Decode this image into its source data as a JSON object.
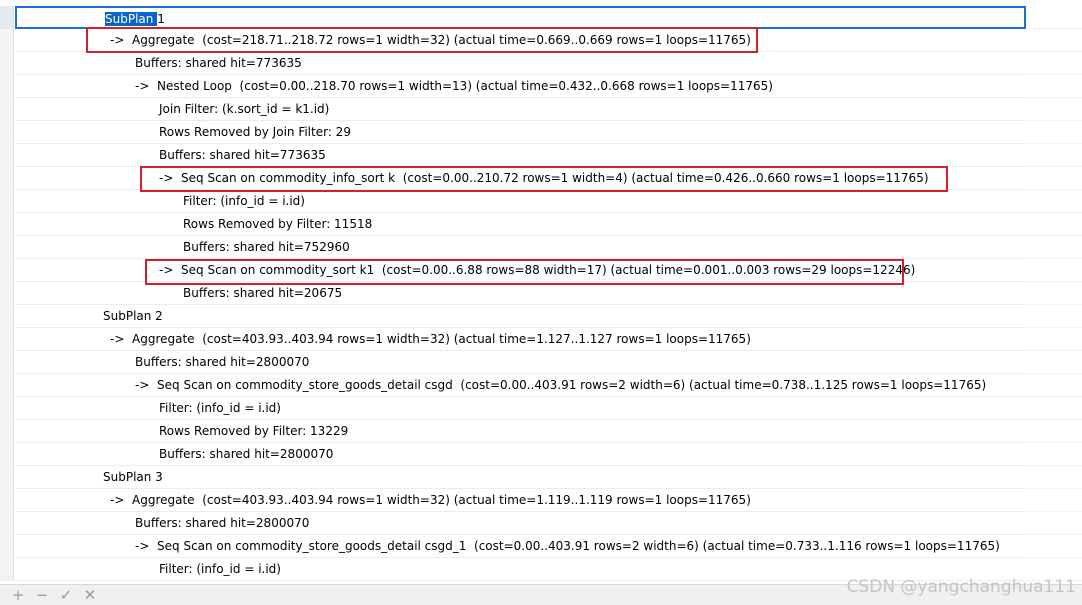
{
  "plan_rows": [
    {
      "segments": [
        {
          "text": "SubPlan ",
          "selected": true
        },
        {
          "text": "1",
          "selected": false
        }
      ]
    },
    {
      "segments": [
        {
          "text": "->  Aggregate  (cost=218.71..218.72 rows=1 width=32) (actual time=0.669..0.669 rows=1 loops=11765)",
          "selected": false
        }
      ]
    },
    {
      "segments": [
        {
          "text": "Buffers: shared hit=773635",
          "selected": false
        }
      ]
    },
    {
      "segments": [
        {
          "text": "->  Nested Loop  (cost=0.00..218.70 rows=1 width=13) (actual time=0.432..0.668 rows=1 loops=11765)",
          "selected": false
        }
      ]
    },
    {
      "segments": [
        {
          "text": "Join Filter: (k.sort_id = k1.id)",
          "selected": false
        }
      ]
    },
    {
      "segments": [
        {
          "text": "Rows Removed by Join Filter: 29",
          "selected": false
        }
      ]
    },
    {
      "segments": [
        {
          "text": "Buffers: shared hit=773635",
          "selected": false
        }
      ]
    },
    {
      "segments": [
        {
          "text": "->  Seq Scan on commodity_info_sort k  (cost=0.00..210.72 rows=1 width=4) (actual time=0.426..0.660 rows=1 loops=11765)",
          "selected": false
        }
      ]
    },
    {
      "segments": [
        {
          "text": "Filter: (info_id = i.id)",
          "selected": false
        }
      ]
    },
    {
      "segments": [
        {
          "text": "Rows Removed by Filter: 11518",
          "selected": false
        }
      ]
    },
    {
      "segments": [
        {
          "text": "Buffers: shared hit=752960",
          "selected": false
        }
      ]
    },
    {
      "segments": [
        {
          "text": "->  Seq Scan on commodity_sort k1  (cost=0.00..6.88 rows=88 width=17) (actual time=0.001..0.003 rows=29 loops=12246)",
          "selected": false
        }
      ]
    },
    {
      "segments": [
        {
          "text": "Buffers: shared hit=20675",
          "selected": false
        }
      ]
    },
    {
      "segments": [
        {
          "text": "SubPlan 2",
          "selected": false
        }
      ]
    },
    {
      "segments": [
        {
          "text": "->  Aggregate  (cost=403.93..403.94 rows=1 width=32) (actual time=1.127..1.127 rows=1 loops=11765)",
          "selected": false
        }
      ]
    },
    {
      "segments": [
        {
          "text": "Buffers: shared hit=2800070",
          "selected": false
        }
      ]
    },
    {
      "segments": [
        {
          "text": "->  Seq Scan on commodity_store_goods_detail csgd  (cost=0.00..403.91 rows=2 width=6) (actual time=0.738..1.125 rows=1 loops=11765)",
          "selected": false
        }
      ]
    },
    {
      "segments": [
        {
          "text": "Filter: (info_id = i.id)",
          "selected": false
        }
      ]
    },
    {
      "segments": [
        {
          "text": "Rows Removed by Filter: 13229",
          "selected": false
        }
      ]
    },
    {
      "segments": [
        {
          "text": "Buffers: shared hit=2800070",
          "selected": false
        }
      ]
    },
    {
      "segments": [
        {
          "text": "SubPlan 3",
          "selected": false
        }
      ]
    },
    {
      "segments": [
        {
          "text": "->  Aggregate  (cost=403.93..403.94 rows=1 width=32) (actual time=1.119..1.119 rows=1 loops=11765)",
          "selected": false
        }
      ]
    },
    {
      "segments": [
        {
          "text": "Buffers: shared hit=2800070",
          "selected": false
        }
      ]
    },
    {
      "segments": [
        {
          "text": "->  Seq Scan on commodity_store_goods_detail csgd_1  (cost=0.00..403.91 rows=2 width=6) (actual time=0.733..1.116 rows=1 loops=11765)",
          "selected": false
        }
      ]
    },
    {
      "segments": [
        {
          "text": "Filter: (info_id = i.id)",
          "selected": false
        }
      ]
    }
  ],
  "toolbar": {
    "add_symbol": "+",
    "remove_symbol": "−",
    "apply_symbol": "✓",
    "cancel_symbol": "✕"
  },
  "watermark": "CSDN @yangchanghua111",
  "colors": {
    "selection_bg": "#0a64c8",
    "active_cell_border": "#1a6fcf",
    "highlight_box": "#d0202a"
  }
}
